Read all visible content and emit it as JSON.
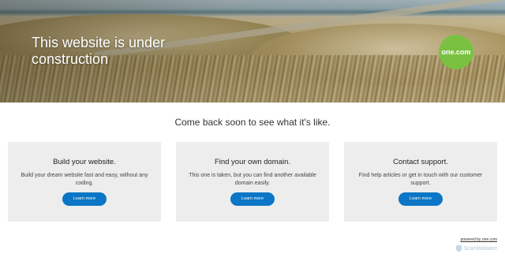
{
  "hero": {
    "title": "This website is under construction",
    "logo_text": "one.com"
  },
  "tagline": "Come back soon to see what it's like.",
  "cards": [
    {
      "title": "Build your website.",
      "text": "Build your dream website fast and easy, without any coding.",
      "button": "Learn more"
    },
    {
      "title": "Find your own domain.",
      "text": "This one is taken, but you can find another available domain easily.",
      "button": "Learn more"
    },
    {
      "title": "Contact support.",
      "text": "Find help articles or get in touch with our customer support.",
      "button": "Learn more"
    }
  ],
  "footer": {
    "powered_by": "powered by one.com",
    "watermark": "ScanMalware"
  },
  "colors": {
    "button": "#0b76c5",
    "logo": "#7ac142",
    "card_bg": "#ededed"
  }
}
